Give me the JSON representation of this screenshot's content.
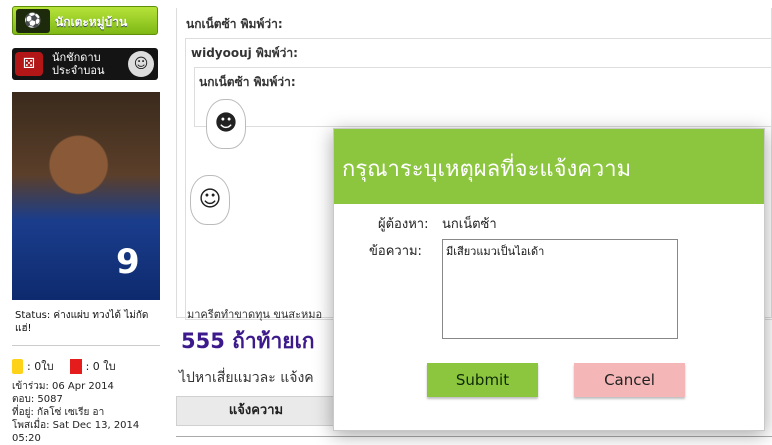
{
  "sidebar": {
    "rank_label": "นักเตะหมู่บ้าน",
    "gambler_label": "นักชักดาบ ประจำบอน",
    "status_text": "Status: ค่างแผ่บ ทวงได้ ไม่กัด แฮ่!",
    "yellow_cards": ": 0ใบ",
    "red_cards": ": 0 ใบ",
    "joined": "เข้าร่วม: 06 Apr 2014",
    "replies": "ตอบ: 5087",
    "location": "ที่อยู่: กัลโซ่ เซเรีย อา",
    "posted": "โพสเมื่อ: Sat Dec 13, 2014 05:20",
    "shirt_number": "9"
  },
  "post": {
    "quote1_header": "นกเน็ตซ้า พิมพ์ว่า:",
    "quote2_header": "widyoouj พิมพ์ว่า:",
    "quote3_header": "นกเน็ตซ้า พิมพ์ว่า:",
    "signature": "มาครีตทำขาดทุน ขนสะหมอ",
    "headline": "555 ถ้าท้ายเก",
    "subline": "ไปหาเสี่ยแมวละ แจ้งค",
    "report_tab": "แจ้งความ"
  },
  "modal": {
    "title": "กรุณาระบุเหตุผลที่จะแจ้งความ",
    "accuser_label": "ผู้ต้องหา:",
    "accuser_value": "นกเน็ตซ้า",
    "message_label": "ข้อความ:",
    "message_value": "มีเสียวแมวเป็นไอเด้า",
    "submit_label": "Submit",
    "cancel_label": "Cancel"
  },
  "colors": {
    "modal_header": "#8cc63f",
    "submit": "#8cc63f",
    "cancel": "#f4b6b6",
    "headline": "#3d1a8c"
  }
}
